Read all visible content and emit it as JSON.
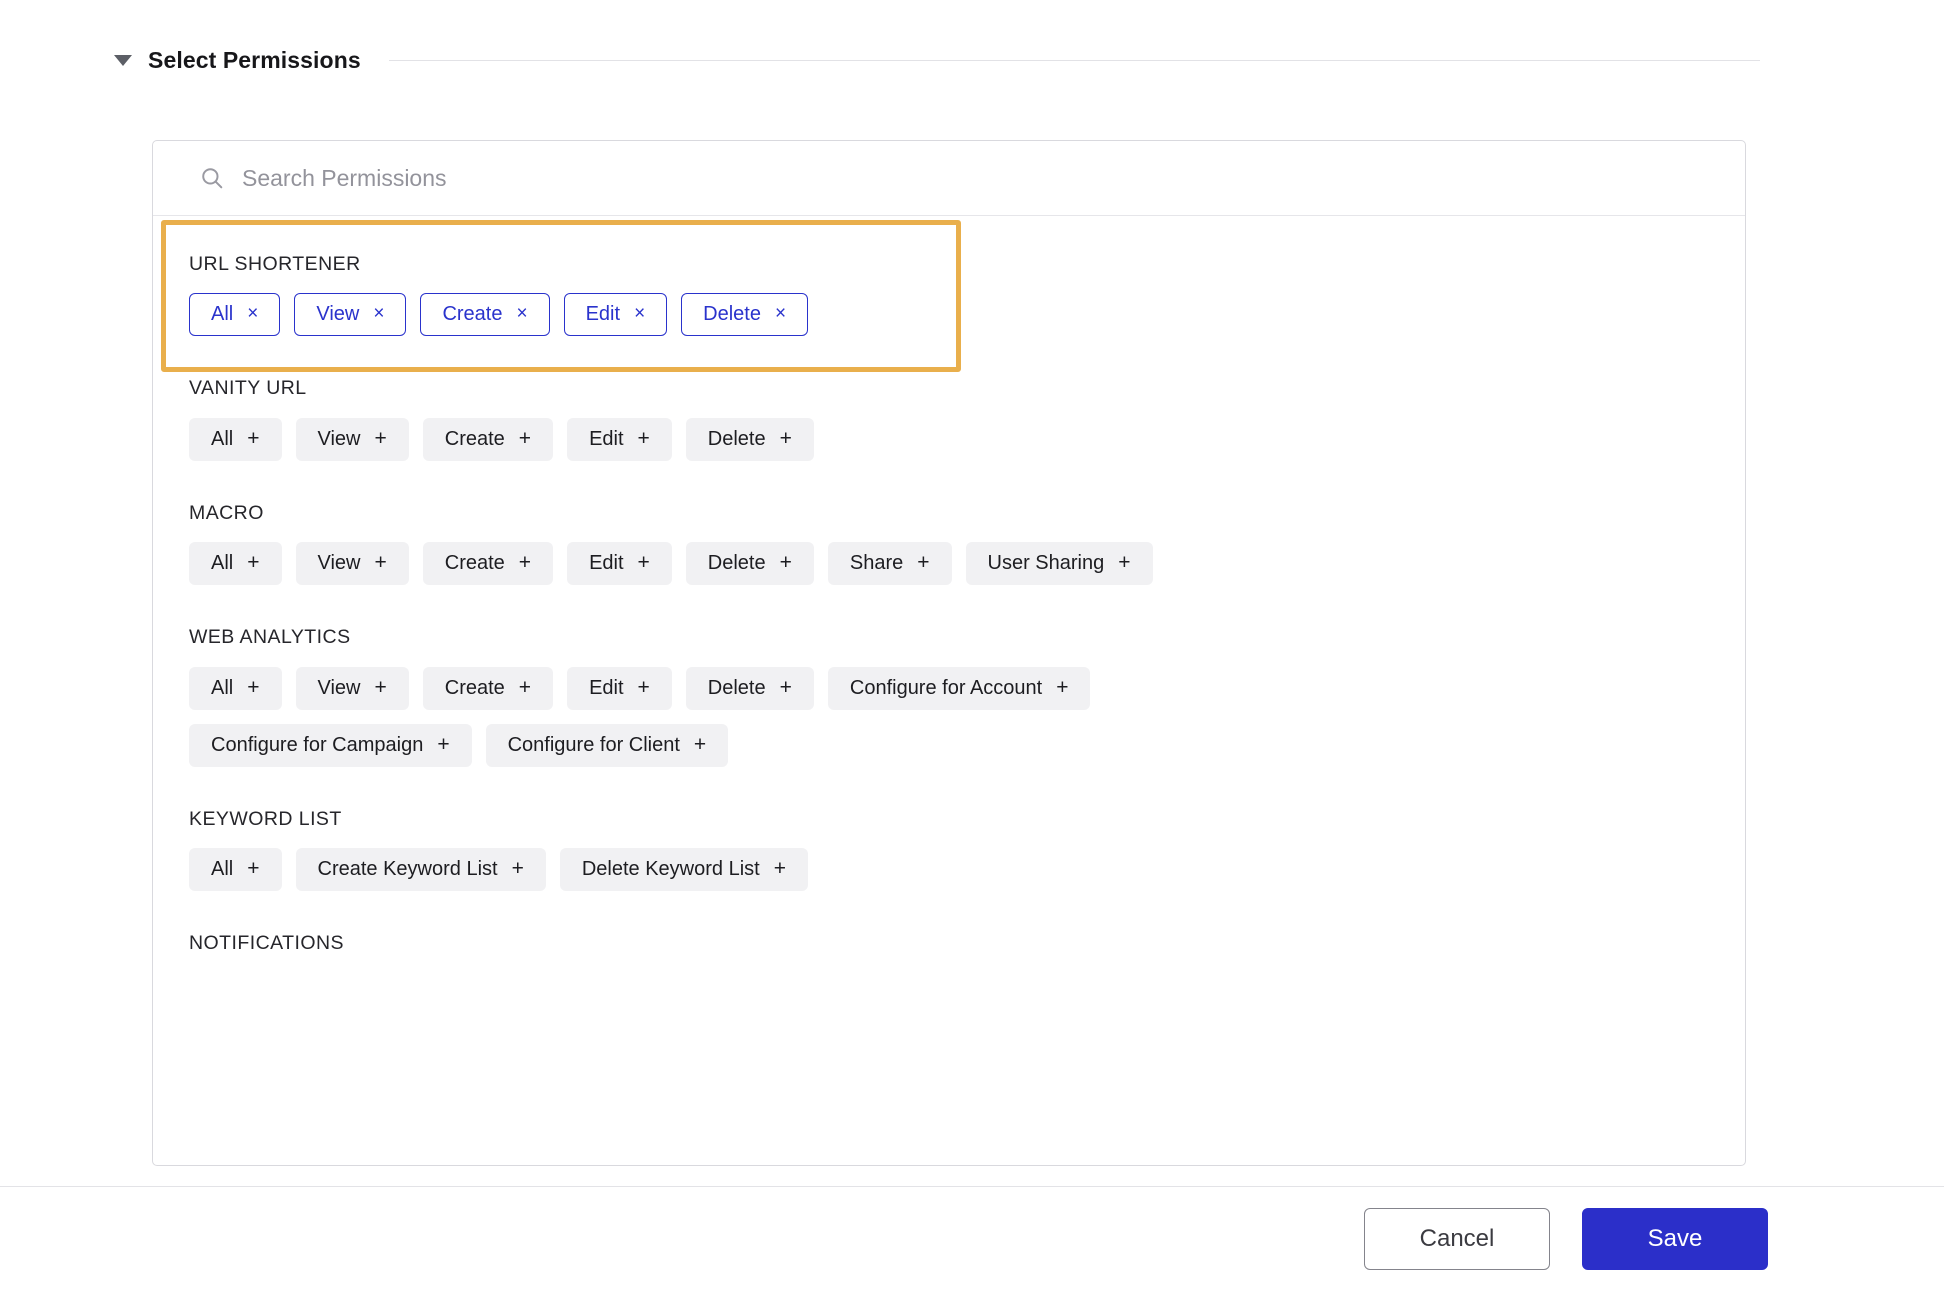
{
  "section": {
    "title": "Select Permissions",
    "caret_icon": "caret-down-icon",
    "expanded": true
  },
  "search": {
    "icon": "search-icon",
    "placeholder": "Search Permissions",
    "value": ""
  },
  "highlight": {
    "color": "#e9af4c",
    "target_group": "URL SHORTENER"
  },
  "theme": {
    "selected_chip_color": "#2a33cc",
    "unselected_chip_bg": "#f1f1f3",
    "save_button_bg": "#2b2fc9",
    "highlight_border": "#e9af4c"
  },
  "groups": [
    {
      "label": "URL SHORTENER",
      "highlighted": true,
      "rows": [
        [
          {
            "label": "All",
            "selected": true,
            "glyph": "×",
            "icon": "close-icon"
          },
          {
            "label": "View",
            "selected": true,
            "glyph": "×",
            "icon": "close-icon"
          },
          {
            "label": "Create",
            "selected": true,
            "glyph": "×",
            "icon": "close-icon"
          },
          {
            "label": "Edit",
            "selected": true,
            "glyph": "×",
            "icon": "close-icon"
          },
          {
            "label": "Delete",
            "selected": true,
            "glyph": "×",
            "icon": "close-icon"
          }
        ]
      ]
    },
    {
      "label": "VANITY URL",
      "highlighted": false,
      "rows": [
        [
          {
            "label": "All",
            "selected": false,
            "glyph": "+",
            "icon": "plus-icon"
          },
          {
            "label": "View",
            "selected": false,
            "glyph": "+",
            "icon": "plus-icon"
          },
          {
            "label": "Create",
            "selected": false,
            "glyph": "+",
            "icon": "plus-icon"
          },
          {
            "label": "Edit",
            "selected": false,
            "glyph": "+",
            "icon": "plus-icon"
          },
          {
            "label": "Delete",
            "selected": false,
            "glyph": "+",
            "icon": "plus-icon"
          }
        ]
      ]
    },
    {
      "label": "MACRO",
      "highlighted": false,
      "rows": [
        [
          {
            "label": "All",
            "selected": false,
            "glyph": "+",
            "icon": "plus-icon"
          },
          {
            "label": "View",
            "selected": false,
            "glyph": "+",
            "icon": "plus-icon"
          },
          {
            "label": "Create",
            "selected": false,
            "glyph": "+",
            "icon": "plus-icon"
          },
          {
            "label": "Edit",
            "selected": false,
            "glyph": "+",
            "icon": "plus-icon"
          },
          {
            "label": "Delete",
            "selected": false,
            "glyph": "+",
            "icon": "plus-icon"
          },
          {
            "label": "Share",
            "selected": false,
            "glyph": "+",
            "icon": "plus-icon"
          },
          {
            "label": "User Sharing",
            "selected": false,
            "glyph": "+",
            "icon": "plus-icon"
          }
        ]
      ]
    },
    {
      "label": "WEB ANALYTICS",
      "highlighted": false,
      "rows": [
        [
          {
            "label": "All",
            "selected": false,
            "glyph": "+",
            "icon": "plus-icon"
          },
          {
            "label": "View",
            "selected": false,
            "glyph": "+",
            "icon": "plus-icon"
          },
          {
            "label": "Create",
            "selected": false,
            "glyph": "+",
            "icon": "plus-icon"
          },
          {
            "label": "Edit",
            "selected": false,
            "glyph": "+",
            "icon": "plus-icon"
          },
          {
            "label": "Delete",
            "selected": false,
            "glyph": "+",
            "icon": "plus-icon"
          },
          {
            "label": "Configure for Account",
            "selected": false,
            "glyph": "+",
            "icon": "plus-icon"
          }
        ],
        [
          {
            "label": "Configure for Campaign",
            "selected": false,
            "glyph": "+",
            "icon": "plus-icon"
          },
          {
            "label": "Configure for Client",
            "selected": false,
            "glyph": "+",
            "icon": "plus-icon"
          }
        ]
      ]
    },
    {
      "label": "KEYWORD LIST",
      "highlighted": false,
      "rows": [
        [
          {
            "label": "All",
            "selected": false,
            "glyph": "+",
            "icon": "plus-icon"
          },
          {
            "label": "Create Keyword List",
            "selected": false,
            "glyph": "+",
            "icon": "plus-icon"
          },
          {
            "label": "Delete Keyword List",
            "selected": false,
            "glyph": "+",
            "icon": "plus-icon"
          }
        ]
      ]
    },
    {
      "label": "NOTIFICATIONS",
      "highlighted": false,
      "rows": []
    }
  ],
  "footer": {
    "cancel_label": "Cancel",
    "save_label": "Save"
  }
}
